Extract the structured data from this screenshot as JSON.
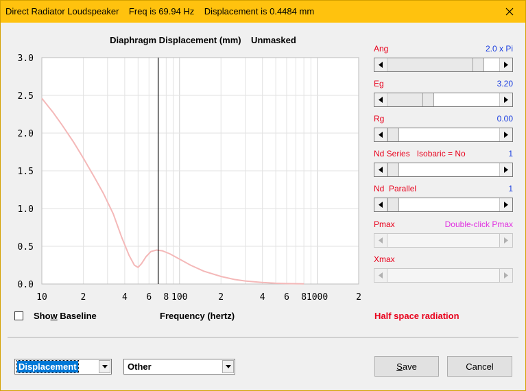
{
  "window": {
    "title": "Direct Radiator Loudspeaker    Freq is 69.94 Hz    Displacement is 0.4484 mm",
    "colors": {
      "titlebar": "#ffc20e",
      "curve": "#f4b8b8",
      "label_red": "#e8001c",
      "value_blue": "#1a3ee0",
      "value_magenta": "#e030e0"
    }
  },
  "plot": {
    "title": "Diaphragm Displacement (mm)    Unmasked",
    "xlabel": "Frequency (hertz)"
  },
  "chart_data": {
    "type": "line",
    "title": "Diaphragm Displacement (mm)    Unmasked",
    "xlabel": "Frequency (hertz)",
    "ylabel": "",
    "x_scale": "log",
    "xlim": [
      10,
      2000
    ],
    "ylim": [
      0,
      3.0
    ],
    "y_ticks": [
      "3.0",
      "2.5",
      "2.0",
      "1.5",
      "1.0",
      "0.5",
      "0.0"
    ],
    "x_tick_labels": [
      {
        "x": 10,
        "label": "10"
      },
      {
        "x": 20,
        "label": "2"
      },
      {
        "x": 40,
        "label": "4"
      },
      {
        "x": 60,
        "label": "6"
      },
      {
        "x": 80,
        "label": "8"
      },
      {
        "x": 100,
        "label": "100"
      },
      {
        "x": 200,
        "label": "2"
      },
      {
        "x": 400,
        "label": "4"
      },
      {
        "x": 600,
        "label": "6"
      },
      {
        "x": 800,
        "label": "8"
      },
      {
        "x": 1000,
        "label": "1000"
      },
      {
        "x": 2000,
        "label": "2"
      }
    ],
    "grid": true,
    "cursor_x": 69.94,
    "series": [
      {
        "x": [
          10,
          12,
          14,
          17,
          20,
          24,
          28,
          33,
          38,
          43,
          47,
          50,
          53,
          57,
          62,
          68,
          75,
          85,
          100,
          120,
          150,
          200,
          250,
          300,
          400,
          500,
          600,
          800
        ],
        "values": [
          2.46,
          2.28,
          2.11,
          1.88,
          1.67,
          1.42,
          1.2,
          0.93,
          0.62,
          0.38,
          0.25,
          0.22,
          0.27,
          0.36,
          0.43,
          0.45,
          0.44,
          0.4,
          0.33,
          0.25,
          0.17,
          0.1,
          0.06,
          0.04,
          0.02,
          0.01,
          0.005,
          0.002
        ]
      }
    ]
  },
  "controls": [
    {
      "label": "Ang",
      "value": "2.0 x Pi",
      "thumb": 0.85,
      "enabled": true
    },
    {
      "label": "Eg",
      "value": "3.20",
      "thumb": 0.35,
      "enabled": true
    },
    {
      "label": "Rg",
      "value": "0.00",
      "thumb": 0.0,
      "enabled": true
    },
    {
      "label": "Nd Series   Isobaric = No",
      "value": "1",
      "thumb": 0.0,
      "enabled": true
    },
    {
      "label": "Nd  Parallel",
      "value": "1",
      "thumb": 0.0,
      "enabled": true
    },
    {
      "label": "Pmax",
      "value": "Double-click Pmax",
      "thumb": null,
      "enabled": false
    },
    {
      "label": "Xmax",
      "value": "",
      "thumb": null,
      "enabled": false
    }
  ],
  "status": {
    "radiation": "Half space radiation"
  },
  "baseline": {
    "label_pre": "Sho",
    "label_accel": "w",
    "label_post": " Baseline",
    "checked": false
  },
  "bottom": {
    "plot_select": "Displacement",
    "other_select": "Other",
    "save_pre": "",
    "save_accel": "S",
    "save_post": "ave",
    "cancel_label": "Cancel"
  }
}
